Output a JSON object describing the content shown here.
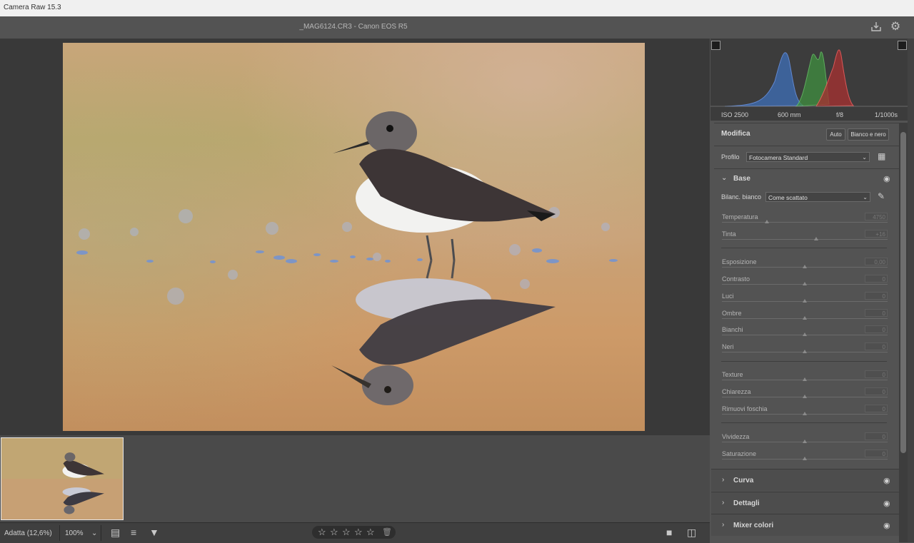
{
  "app": {
    "title": "Camera Raw 15.3"
  },
  "header": {
    "filename": "_MAG6124.CR3  -  Canon EOS R5",
    "save_icon": "save-icon",
    "settings_icon": "gear-icon"
  },
  "exif": {
    "iso": "ISO 2500",
    "focal": "600 mm",
    "aperture": "f/8",
    "shutter": "1/1000s"
  },
  "edit": {
    "title": "Modifica",
    "auto_label": "Auto",
    "bw_label": "Bianco e nero",
    "profile_label": "Profilo",
    "profile_value": "Fotocamera Standard"
  },
  "base": {
    "title": "Base",
    "wb_label": "Bilanc. bianco",
    "wb_value": "Come scattato",
    "sliders": [
      {
        "label": "Temperatura",
        "value": "4750",
        "pos": 0.27
      },
      {
        "label": "Tinta",
        "value": "+16",
        "pos": 0.57
      },
      {
        "label": "Esposizione",
        "value": "0,00",
        "pos": 0.5
      },
      {
        "label": "Contrasto",
        "value": "0",
        "pos": 0.5
      },
      {
        "label": "Luci",
        "value": "0",
        "pos": 0.5
      },
      {
        "label": "Ombre",
        "value": "0",
        "pos": 0.5
      },
      {
        "label": "Bianchi",
        "value": "0",
        "pos": 0.5
      },
      {
        "label": "Neri",
        "value": "0",
        "pos": 0.5
      },
      {
        "label": "Texture",
        "value": "0",
        "pos": 0.5
      },
      {
        "label": "Chiarezza",
        "value": "0",
        "pos": 0.5
      },
      {
        "label": "Rimuovi foschia",
        "value": "0",
        "pos": 0.5
      },
      {
        "label": "Vividezza",
        "value": "0",
        "pos": 0.5
      },
      {
        "label": "Saturazione",
        "value": "0",
        "pos": 0.5
      }
    ]
  },
  "sections": [
    {
      "label": "Curva"
    },
    {
      "label": "Dettagli"
    },
    {
      "label": "Mixer colori"
    }
  ],
  "bottom": {
    "zoom_fit": "Adatta (12,6%)",
    "zoom_100": "100%",
    "rating": 0,
    "rating_max": 5
  },
  "colors": {
    "accent": "#cfcfcf",
    "panel": "#535353",
    "workspace": "#393939"
  }
}
